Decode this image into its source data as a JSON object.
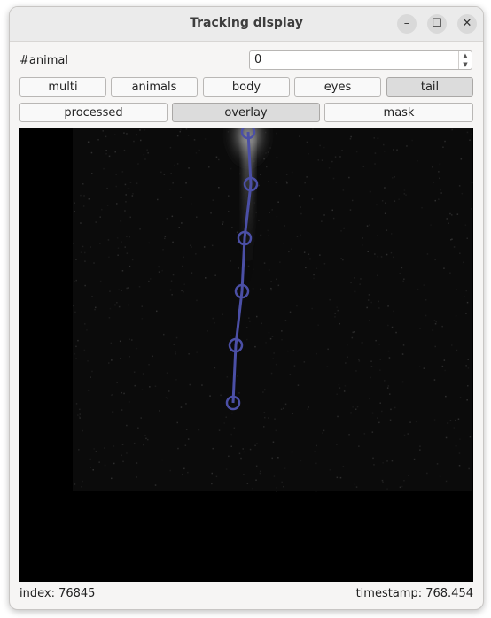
{
  "window": {
    "title": "Tracking display",
    "min_glyph": "–",
    "max_glyph": "☐",
    "close_glyph": "✕"
  },
  "animal": {
    "label": "#animal",
    "value": "0"
  },
  "mode_buttons": [
    {
      "label": "multi",
      "checked": false
    },
    {
      "label": "animals",
      "checked": false
    },
    {
      "label": "body",
      "checked": false
    },
    {
      "label": "eyes",
      "checked": false
    },
    {
      "label": "tail",
      "checked": true
    }
  ],
  "view_buttons": [
    {
      "label": "processed",
      "checked": false
    },
    {
      "label": "overlay",
      "checked": true
    },
    {
      "label": "mask",
      "checked": false
    }
  ],
  "status": {
    "index_label": "index:",
    "index_value": "76845",
    "timestamp_label": "timestamp:",
    "timestamp_value": "768.454"
  },
  "colors": {
    "overlay": "#4b4fa6",
    "glow": "#bcbcbc"
  }
}
